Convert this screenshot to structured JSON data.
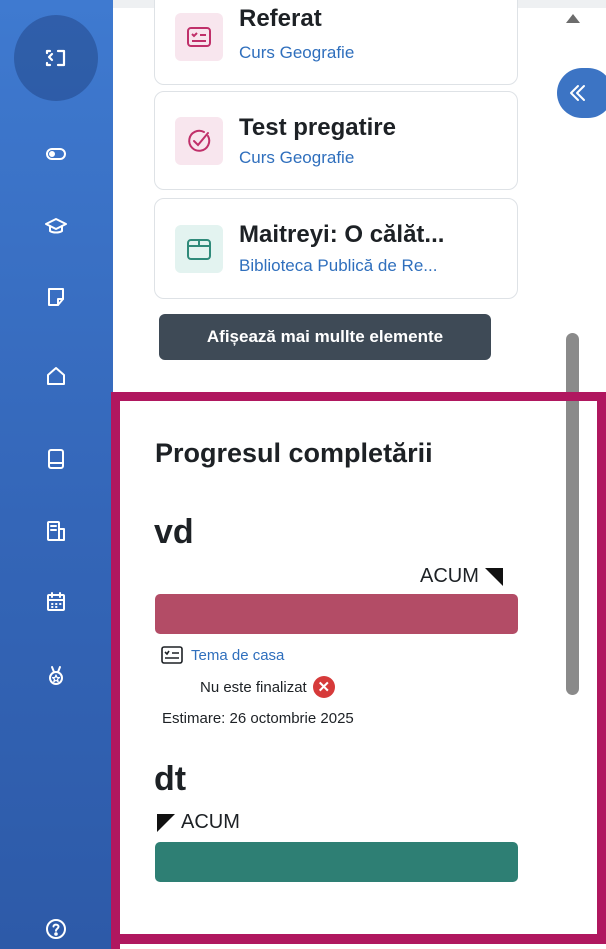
{
  "recent_items": [
    {
      "title": "Referat",
      "course": "Curs Geografie",
      "icon": "assignment-icon",
      "icon_color": "#c0306a",
      "icon_bg": "#f8e6ee"
    },
    {
      "title": "Test pregatire",
      "course": "Curs Geografie",
      "icon": "quiz-check-icon",
      "icon_color": "#c0306a",
      "icon_bg": "#f8e6ee"
    },
    {
      "title": "Maitreyi: O călăt...",
      "course": "Biblioteca Publică de Re...",
      "icon": "package-icon",
      "icon_color": "#2f8a7a",
      "icon_bg": "#e3f3f0"
    }
  ],
  "show_more_label": "Afișează mai mullte elemente",
  "progress": {
    "title": "Progresul completării",
    "now_label": "ACUM",
    "users": [
      {
        "name": "vd",
        "bar_color": "#b34c66",
        "marker_position": 1.0,
        "activity": {
          "label": "Tema de casa",
          "icon": "assignment-icon"
        },
        "status": "Nu este finalizat",
        "estimate": "Estimare: 26 octombrie 2025"
      },
      {
        "name": "dt",
        "bar_color": "#2e7f74",
        "marker_position": 0.0
      }
    ]
  },
  "colors": {
    "rail": "#3466b8",
    "highlight": "#b0175f",
    "button": "#3e4a56",
    "link": "#2f6fbd"
  }
}
